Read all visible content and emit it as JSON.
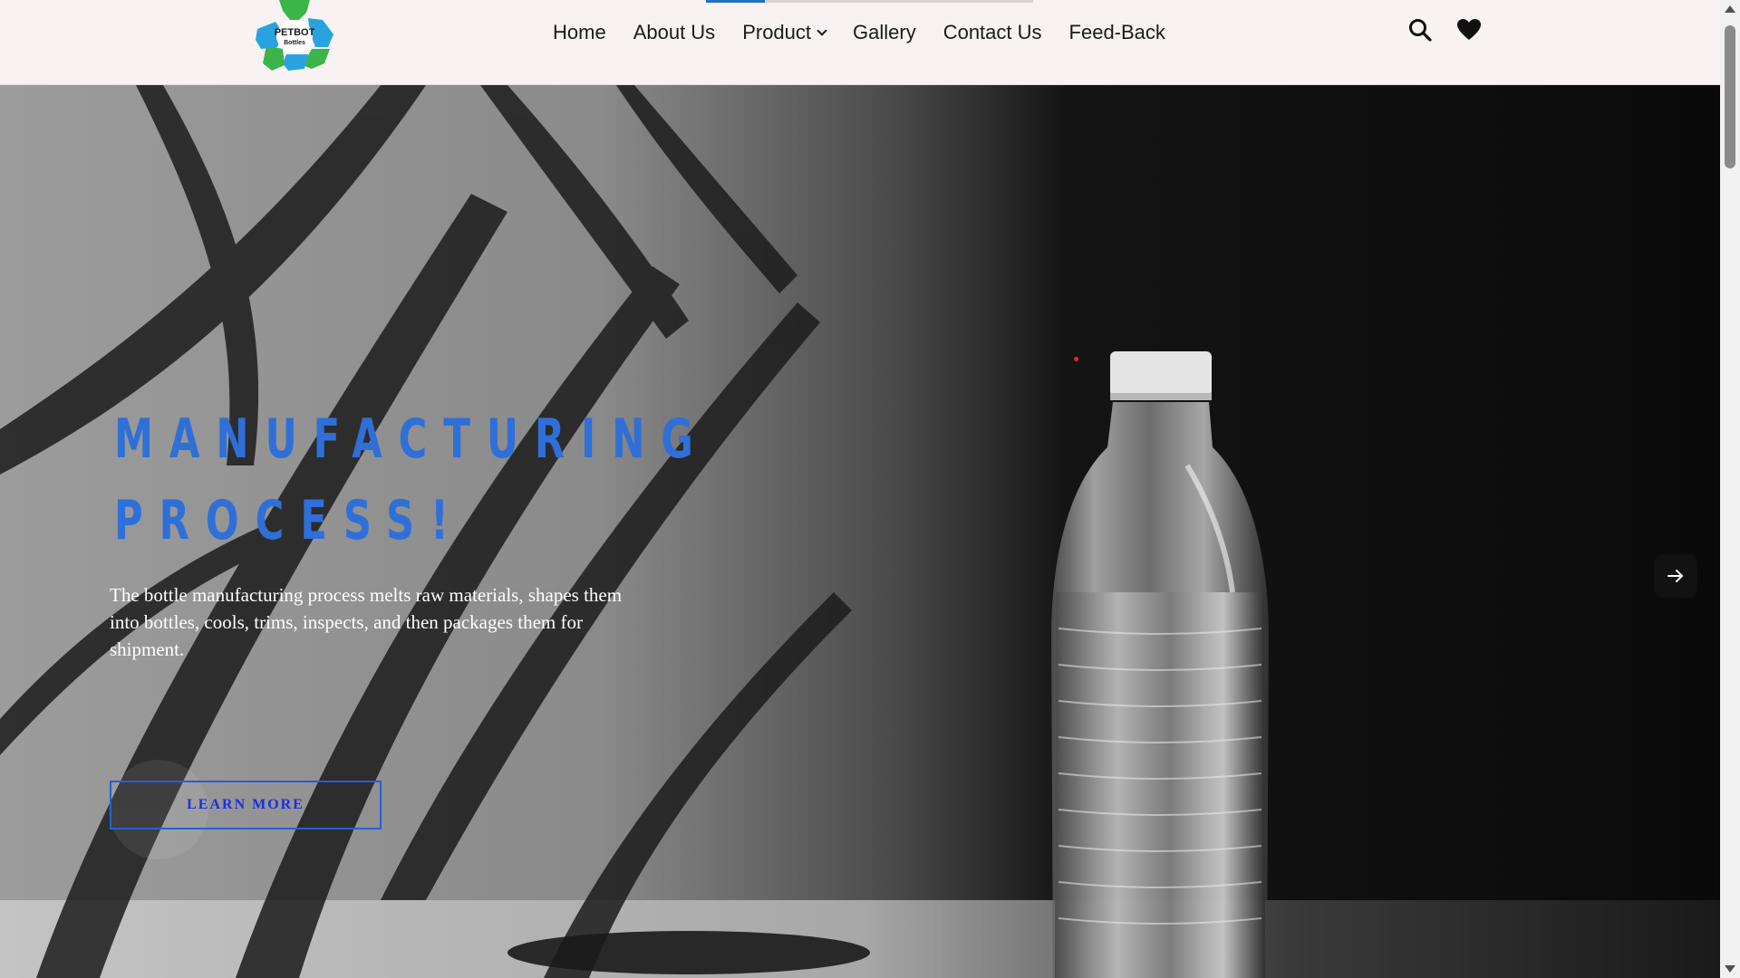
{
  "brand": {
    "logo_line1": "PETBOT",
    "logo_line2": "Bottles",
    "logo_icon": "recycle-logo"
  },
  "nav": {
    "items": [
      {
        "label": "Home"
      },
      {
        "label": "About Us"
      },
      {
        "label": "Product",
        "has_dropdown": true
      },
      {
        "label": "Gallery"
      },
      {
        "label": "Contact Us"
      },
      {
        "label": "Feed-Back"
      }
    ],
    "slide_progress_percent": 18
  },
  "header_icons": {
    "search": "search-icon",
    "wishlist": "heart-icon"
  },
  "hero": {
    "title": "MANUFACTURING\nPROCESS!",
    "description": "The bottle manufacturing process melts raw materials, shapes them into bottles, cools, trims, inspects, and then packages them for shipment.",
    "button_label": "LEARN MORE",
    "next_icon": "arrow-right-icon"
  },
  "colors": {
    "accent_blue": "#2f6fd8",
    "button_text": "#1b2fe0",
    "header_bg": "#f8f3f2",
    "logo_green": "#3bb54a",
    "logo_blue": "#29a3e0"
  }
}
